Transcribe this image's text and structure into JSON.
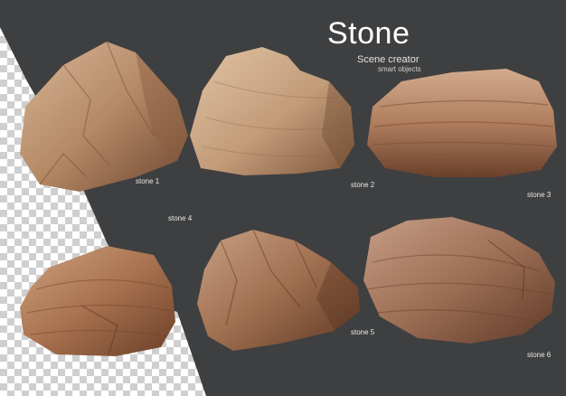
{
  "header": {
    "title": "Stone",
    "subtitle": "Scene creator",
    "tagline": "smart objects"
  },
  "stones": [
    {
      "label": "stone 1",
      "icon": "stone-rock-icon"
    },
    {
      "label": "stone 2",
      "icon": "stone-rock-icon"
    },
    {
      "label": "stone 3",
      "icon": "stone-rock-icon"
    },
    {
      "label": "stone 4",
      "icon": "stone-rock-icon"
    },
    {
      "label": "stone 5",
      "icon": "stone-rock-icon"
    },
    {
      "label": "stone 6",
      "icon": "stone-rock-icon"
    }
  ],
  "colors": {
    "panel": "#3e3f40",
    "checker_light": "#ffffff",
    "checker_dark": "#cfcfcf",
    "stone_light": "#c9a382",
    "stone_dark": "#7a4f34"
  }
}
